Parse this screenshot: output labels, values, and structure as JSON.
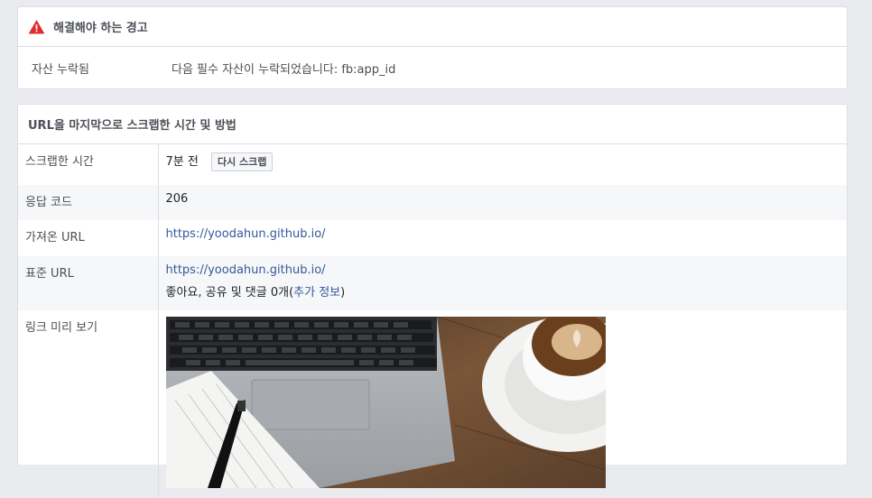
{
  "warnings": {
    "title": "해결해야 하는 경고",
    "rows": [
      {
        "label": "자산 누락됨",
        "value": "다음 필수 자산이 누락되었습니다: fb:app_id"
      }
    ]
  },
  "scrape": {
    "title": "URL을 마지막으로 스크랩한 시간 및 방법",
    "time_label": "스크랩한 시간",
    "time_value": "7분 전",
    "rescrape_button": "다시 스크랩",
    "response_label": "응답 코드",
    "response_value": "206",
    "fetched_label": "가져온 URL",
    "fetched_url": "https://yoodahun.github.io/",
    "canonical_label": "표준 URL",
    "canonical_url": "https://yoodahun.github.io/",
    "engagement_prefix": "좋아요, 공유 및 댓글 0개(",
    "more_info": "추가 정보",
    "engagement_suffix": ")",
    "preview_label": "링크 미리 보기"
  },
  "colors": {
    "warning_red": "#e02b2b",
    "link_blue": "#365899"
  }
}
